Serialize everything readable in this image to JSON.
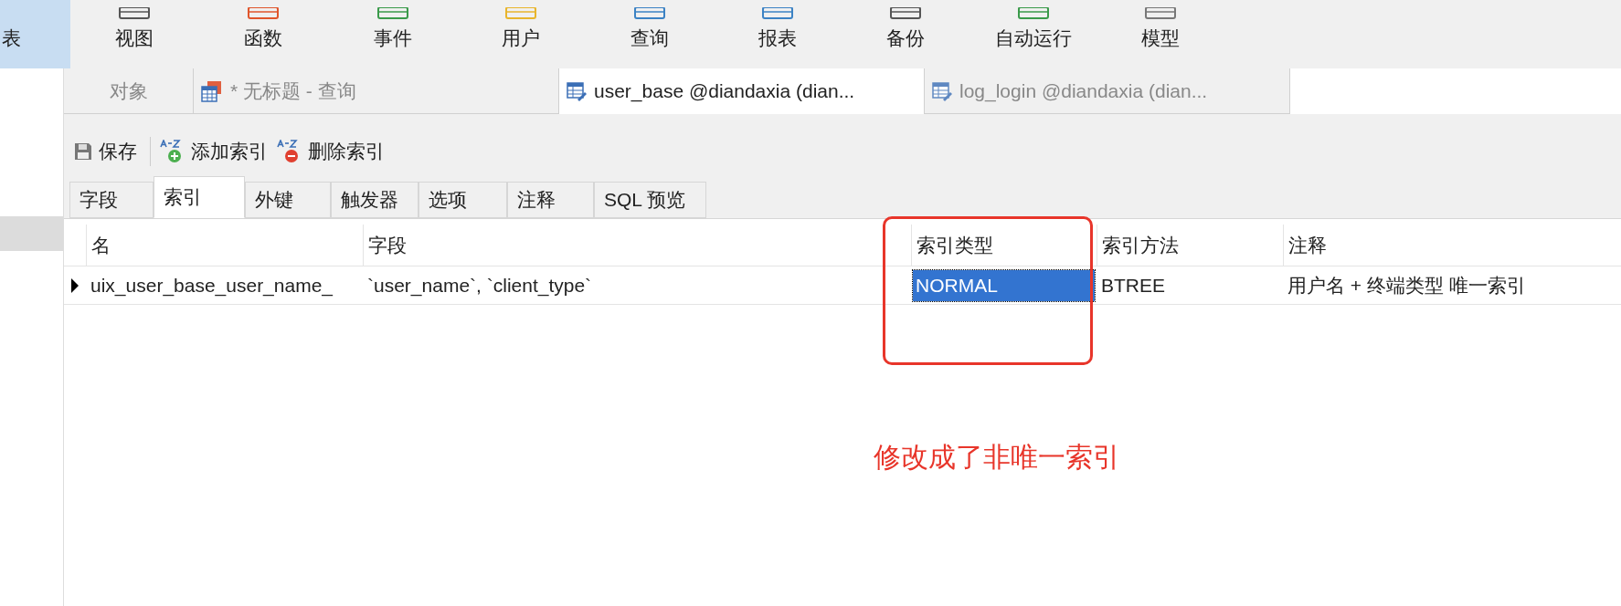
{
  "ribbon": [
    {
      "label": "表",
      "selected": true
    },
    {
      "label": "视图",
      "selected": false
    },
    {
      "label": "函数",
      "selected": false
    },
    {
      "label": "事件",
      "selected": false
    },
    {
      "label": "用户",
      "selected": false
    },
    {
      "label": "查询",
      "selected": false
    },
    {
      "label": "报表",
      "selected": false
    },
    {
      "label": "备份",
      "selected": false
    },
    {
      "label": "自动运行",
      "selected": false
    },
    {
      "label": "模型",
      "selected": false
    }
  ],
  "doc_tabs": [
    {
      "label": "对象",
      "kind": "objects",
      "selected": false
    },
    {
      "label": "* 无标题 - 查询",
      "kind": "query",
      "selected": false
    },
    {
      "label": "user_base @diandaxia (dian...",
      "kind": "table",
      "selected": true
    },
    {
      "label": "log_login @diandaxia (dian...",
      "kind": "table",
      "selected": false
    }
  ],
  "toolbar": [
    {
      "label": "保存",
      "kind": "save"
    },
    {
      "label": "添加索引",
      "kind": "add"
    },
    {
      "label": "删除索引",
      "kind": "delete"
    }
  ],
  "sub_tabs": [
    {
      "label": "字段",
      "selected": false
    },
    {
      "label": "索引",
      "selected": true
    },
    {
      "label": "外键",
      "selected": false
    },
    {
      "label": "触发器",
      "selected": false
    },
    {
      "label": "选项",
      "selected": false
    },
    {
      "label": "注释",
      "selected": false
    },
    {
      "label": "SQL 预览",
      "selected": false
    }
  ],
  "table": {
    "columns": [
      "名",
      "字段",
      "索引类型",
      "索引方法",
      "注释"
    ],
    "rows": [
      {
        "current": true,
        "cells": [
          {
            "text": "uix_user_base_user_name_",
            "selected": false
          },
          {
            "text": "`user_name`, `client_type`",
            "selected": false
          },
          {
            "text": "NORMAL",
            "selected": true
          },
          {
            "text": "BTREE",
            "selected": false
          },
          {
            "text": "用户名 + 终端类型 唯一索引",
            "selected": false
          }
        ]
      }
    ]
  },
  "annotation": {
    "note": "修改成了非唯一索引"
  }
}
